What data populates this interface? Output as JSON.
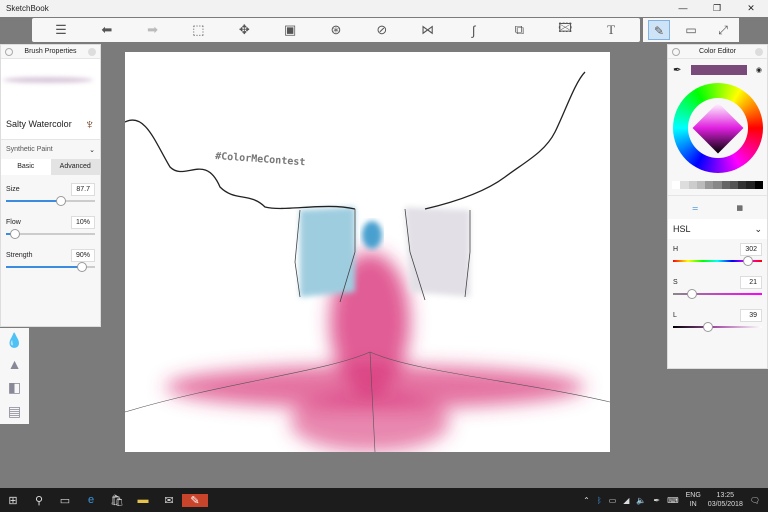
{
  "app": {
    "title": "SketchBook"
  },
  "canvas": {
    "hashtag": "#ColorMeContest"
  },
  "brush": {
    "panel_title": "Brush Properties",
    "name": "Salty Watercolor",
    "category": "Synthetic Paint",
    "tabs": [
      "Basic",
      "Advanced"
    ],
    "size_label": "Size",
    "size": "87.7",
    "size_pct": 0.62,
    "flow_label": "Flow",
    "flow": "10%",
    "flow_pct": 0.1,
    "strength_label": "Strength",
    "strength": "90%",
    "strength_pct": 0.85
  },
  "color": {
    "panel_title": "Color Editor",
    "current": "#7a4a7a",
    "mode": "HSL",
    "h_label": "H",
    "h": "302",
    "s_label": "S",
    "s": "21",
    "l_label": "L",
    "l": "39",
    "h_pct": 0.84,
    "s_pct": 0.21,
    "l_pct": 0.39
  },
  "taskbar": {
    "lang1": "ENG",
    "lang2": "IN",
    "time": "13:25",
    "date": "03/05/2018"
  }
}
